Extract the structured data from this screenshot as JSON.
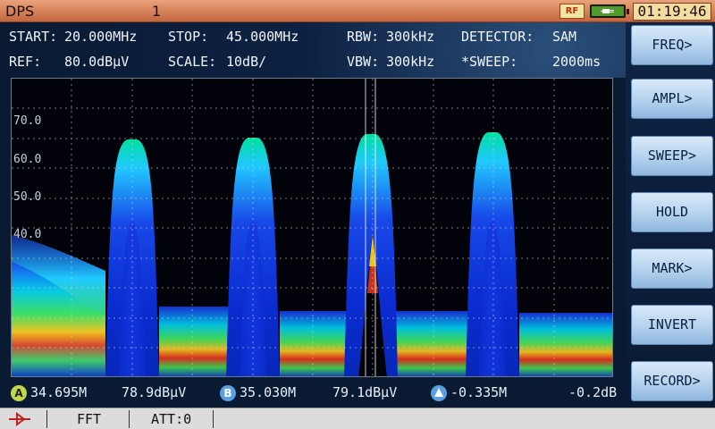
{
  "titlebar": {
    "app_title": "DPS",
    "page_number": "1",
    "rf_indicator": "RF",
    "battery_icon": "battery-charging-icon",
    "clock": "01:19:46"
  },
  "params": {
    "start_label": "START:",
    "start_value": "20.000MHz",
    "stop_label": "STOP:",
    "stop_value": "45.000MHz",
    "rbw_label": "RBW:",
    "rbw_value": "300kHz",
    "detector_label": "DETECTOR:",
    "detector_value": "SAM",
    "ref_label": "REF:",
    "ref_value": "80.0dBμV",
    "scale_label": "SCALE:",
    "scale_value": "10dB/",
    "vbw_label": "VBW:",
    "vbw_value": "300kHz",
    "sweep_label": "*SWEEP:",
    "sweep_value": "2000ms"
  },
  "plot": {
    "y_tick_labels": [
      "70.0",
      "60.0",
      "50.0",
      "40.0"
    ],
    "display": "persistence spectrum",
    "colors": {
      "background": "#02030a",
      "grid": "#d8d8d8",
      "marker_line": "#ffffff"
    }
  },
  "markers": {
    "a_badge": "A",
    "a_freq": "34.695M",
    "a_level": "78.9dBμV",
    "b_badge": "B",
    "b_freq": "35.030M",
    "b_level": "79.1dBμV",
    "delta_icon": "delta-triangle-icon",
    "delta_freq": "-0.335M",
    "delta_level": "-0.2dB"
  },
  "statusbar": {
    "input_icon": "rf-input-icon",
    "mode": "FFT",
    "attenuation": "ATT:0"
  },
  "softkeys": [
    "FREQ>",
    "AMPL>",
    "SWEEP>",
    "HOLD",
    "MARK>",
    "INVERT",
    "RECORD>"
  ],
  "colors": {
    "titlebar": "#d07a50",
    "softkey": "#b4d2ee",
    "marker_a": "#c2d84a",
    "marker_b": "#5aa0e0"
  }
}
